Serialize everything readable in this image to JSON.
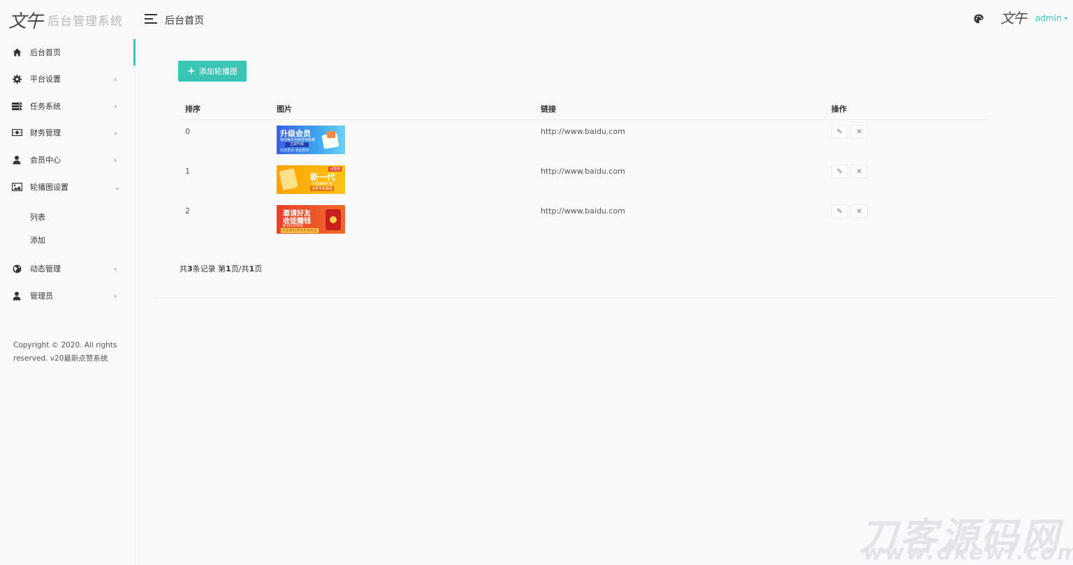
{
  "app": {
    "logo_mark": "文午",
    "logo_text": "后台管理系统",
    "header_title": "后台首页",
    "avatar_mark": "文午",
    "username": "admin"
  },
  "sidebar": {
    "items": [
      {
        "label": "后台首页",
        "icon": "home-icon"
      },
      {
        "label": "平台设置",
        "icon": "gear-icon"
      },
      {
        "label": "任务系统",
        "icon": "server-icon"
      },
      {
        "label": "财务管理",
        "icon": "money-icon"
      },
      {
        "label": "会员中心",
        "icon": "user-icon"
      },
      {
        "label": "轮播图设置",
        "icon": "image-icon"
      },
      {
        "label": "动态管理",
        "icon": "globe-icon"
      },
      {
        "label": "管理员",
        "icon": "user-icon"
      }
    ],
    "sub_items": [
      "列表",
      "添加"
    ],
    "copyright": "Copyright © 2020. All rights reserved. v20最新点赞系统"
  },
  "main": {
    "add_button": "添加轮播图",
    "columns": [
      "排序",
      "图片",
      "链接",
      "操作"
    ],
    "rows": [
      {
        "order": "0",
        "link": "http://www.baidu.com",
        "banner": {
          "title": "升级会员",
          "line2": "增加每日可做任务数量",
          "line3": "立即升级",
          "footer": "任务更多  收益更多"
        }
      },
      {
        "order": "1",
        "link": "http://www.baidu.com",
        "banner": {
          "tag": "点赞网",
          "title": "新一代",
          "line2": "手机赚钱平台",
          "line3": "点赞手机赚钱",
          "footer": ""
        }
      },
      {
        "order": "2",
        "link": "http://www.baidu.com",
        "banner": {
          "title": "邀请好友",
          "line2": "收徒赚钱",
          "line3": "邀请好友赚钱",
          "footer": "好友做任务你也有收益"
        }
      }
    ],
    "pagination": {
      "prefix": "共",
      "total": "3",
      "mid": "条记录 第",
      "page": "1",
      "mid2": "页/共",
      "pages": "1",
      "suffix": "页"
    }
  },
  "watermark": {
    "cn": "刀客源码网",
    "en": "www.dkewl.com"
  },
  "colors": {
    "accent": "#3ac4b4",
    "banner0": "#3a6fe0",
    "banner1": "#f7b500",
    "banner2": "#e8402a"
  }
}
